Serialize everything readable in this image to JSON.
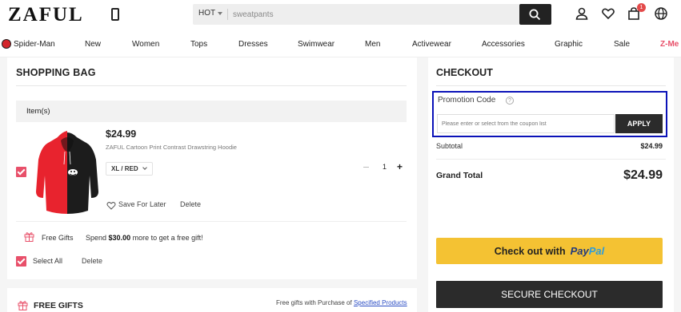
{
  "header": {
    "logo": "ZAFUL",
    "search": {
      "category": "HOT",
      "placeholder": "sweatpants"
    },
    "cart_count": "1"
  },
  "nav": {
    "items": [
      "Spider-Man",
      "New",
      "Women",
      "Tops",
      "Dresses",
      "Swimwear",
      "Men",
      "Activewear",
      "Accessories",
      "Graphic",
      "Sale",
      "Z-Me"
    ],
    "accent_color": "#e8506a"
  },
  "bag": {
    "title": "SHOPPING BAG",
    "items_header": "Item(s)",
    "item": {
      "price": "$24.99",
      "name": "ZAFUL Cartoon Print Contrast Drawstring Hoodie",
      "variant": "XL / RED",
      "quantity": "1",
      "save_for_later": "Save For Later",
      "delete": "Delete"
    },
    "free_gifts_label": "Free Gifts",
    "spend_prefix": "Spend",
    "spend_amount": "$30.00",
    "spend_suffix": "more to get a free gift!",
    "select_all": "Select All",
    "delete_all": "Delete"
  },
  "gifts_panel": {
    "title": "FREE GIFTS",
    "note": "Free gifts with Purchase of",
    "link": "Specified Products"
  },
  "checkout": {
    "title": "CHECKOUT",
    "promo_label": "Promotion Code",
    "promo_placeholder": "Please enter or select from the coupon list",
    "apply": "APPLY",
    "subtotal_label": "Subtotal",
    "subtotal_value": "$24.99",
    "grand_total_label": "Grand Total",
    "grand_total_value": "$24.99",
    "paypal_prefix": "Check out with",
    "paypal_brand_1": "Pay",
    "paypal_brand_2": "Pal",
    "secure_checkout": "SECURE CHECKOUT"
  }
}
